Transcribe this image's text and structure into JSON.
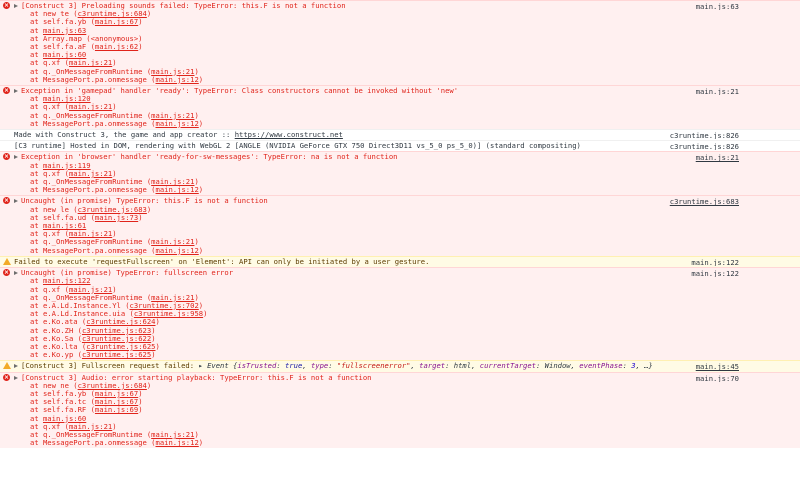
{
  "messages": [
    {
      "type": "error",
      "text": "[Construct 3] Preloading sounds failed:  TypeError: this.F is not a function",
      "source": "main.js:63",
      "frames": [
        {
          "pre": "at new te (",
          "loc": "c3runtime.js:684",
          "post": ")"
        },
        {
          "pre": "at self.fa.yb (",
          "loc": "main.js:67",
          "post": ")"
        },
        {
          "pre": "at ",
          "loc": "main.js:63",
          "post": ""
        },
        {
          "pre": "at Array.map (<anonymous>)",
          "loc": "",
          "post": ""
        },
        {
          "pre": "at self.fa.aF (",
          "loc": "main.js:62",
          "post": ")"
        },
        {
          "pre": "at ",
          "loc": "main.js:60",
          "post": ""
        },
        {
          "pre": "at q.xf (",
          "loc": "main.js:21",
          "post": ")"
        },
        {
          "pre": "at q._OnMessageFromRuntime (",
          "loc": "main.js:21",
          "post": ")"
        },
        {
          "pre": "at MessagePort.pa.onmessage (",
          "loc": "main.js:12",
          "post": ")"
        }
      ]
    },
    {
      "type": "error",
      "text": "Exception in 'gamepad' handler 'ready': TypeError: Class constructors cannot be invoked without 'new'",
      "source": "main.js:21",
      "frames": [
        {
          "pre": "at ",
          "loc": "main.js:120",
          "post": ""
        },
        {
          "pre": "at q.xf (",
          "loc": "main.js:21",
          "post": ")"
        },
        {
          "pre": "at q._OnMessageFromRuntime (",
          "loc": "main.js:21",
          "post": ")"
        },
        {
          "pre": "at MessagePort.pa.onmessage (",
          "loc": "main.js:12",
          "post": ")"
        }
      ]
    },
    {
      "type": "log",
      "text": "Made with Construct 3, the game and app creator :: ",
      "link": "https://www.construct.net",
      "source": "c3runtime.js:826",
      "frames": []
    },
    {
      "type": "log",
      "text": "[C3 runtime] Hosted in DOM, rendering with WebGL 2 [ANGLE (NVIDIA GeForce GTX 750 Direct3D11 vs_5_0 ps_5_0)] (standard compositing)",
      "source": "c3runtime.js:826",
      "frames": []
    },
    {
      "type": "error",
      "text": "Exception in 'browser' handler 'ready-for-sw-messages': TypeError: na is not a function",
      "source": "main.js:21",
      "frames": [
        {
          "pre": "at ",
          "loc": "main.js:119",
          "post": ""
        },
        {
          "pre": "at q.xf (",
          "loc": "main.js:21",
          "post": ")"
        },
        {
          "pre": "at q._OnMessageFromRuntime (",
          "loc": "main.js:21",
          "post": ")"
        },
        {
          "pre": "at MessagePort.pa.onmessage (",
          "loc": "main.js:12",
          "post": ")"
        }
      ]
    },
    {
      "type": "error",
      "text": "Uncaught (in promise) TypeError: this.F is not a function",
      "source": "c3runtime.js:683",
      "frames": [
        {
          "pre": "at new le (",
          "loc": "c3runtime.js:683",
          "post": ")"
        },
        {
          "pre": "at self.fa.ud (",
          "loc": "main.js:73",
          "post": ")"
        },
        {
          "pre": "at ",
          "loc": "main.js:61",
          "post": ""
        },
        {
          "pre": "at q.xf (",
          "loc": "main.js:21",
          "post": ")"
        },
        {
          "pre": "at q._OnMessageFromRuntime (",
          "loc": "main.js:21",
          "post": ")"
        },
        {
          "pre": "at MessagePort.pa.onmessage (",
          "loc": "main.js:12",
          "post": ")"
        }
      ]
    },
    {
      "type": "warn",
      "text": "Failed to execute 'requestFullscreen' on 'Element': API can only be initiated by a user gesture.",
      "source": "main.js:122",
      "frames": []
    },
    {
      "type": "error",
      "text": "Uncaught (in promise) TypeError: fullscreen error",
      "source": "main.js:122",
      "frames": [
        {
          "pre": "at ",
          "loc": "main.js:122",
          "post": ""
        },
        {
          "pre": "at q.xf (",
          "loc": "main.js:21",
          "post": ")"
        },
        {
          "pre": "at q._OnMessageFromRuntime (",
          "loc": "main.js:21",
          "post": ")"
        },
        {
          "pre": "at e.A.Ld.Instance.Yl (",
          "loc": "c3runtime.js:702",
          "post": ")"
        },
        {
          "pre": "at e.A.Ld.Instance.uia (",
          "loc": "c3runtime.js:958",
          "post": ")"
        },
        {
          "pre": "at e.Ko.ata (",
          "loc": "c3runtime.js:624",
          "post": ")"
        },
        {
          "pre": "at e.Ko.ZH (",
          "loc": "c3runtime.js:623",
          "post": ")"
        },
        {
          "pre": "at e.Ko.Sa (",
          "loc": "c3runtime.js:622",
          "post": ")"
        },
        {
          "pre": "at e.Ko.lta (",
          "loc": "c3runtime.js:625",
          "post": ")"
        },
        {
          "pre": "at e.Ko.yp (",
          "loc": "c3runtime.js:625",
          "post": ")"
        }
      ]
    },
    {
      "type": "warn",
      "text": "[Construct 3] Fullscreen request failed:  ",
      "object": {
        "lead": "Event {",
        "parts": [
          {
            "k": "isTrusted",
            "v": "true",
            "vt": "bv"
          },
          {
            "k": "type",
            "v": "\"fullscreenerror\"",
            "vt": "sv"
          },
          {
            "k": "target",
            "v": "html",
            "vt": ""
          },
          {
            "k": "currentTarget",
            "v": "Window",
            "vt": ""
          },
          {
            "k": "eventPhase",
            "v": "3",
            "vt": "nv"
          }
        ],
        "tail": ", …}"
      },
      "source": "main.js:45",
      "frames": []
    },
    {
      "type": "error",
      "text": "[Construct 3] Audio: error starting playback:  TypeError: this.F is not a function",
      "source": "main.js:70",
      "frames": [
        {
          "pre": "at new ne (",
          "loc": "c3runtime.js:684",
          "post": ")"
        },
        {
          "pre": "at self.fa.yb (",
          "loc": "main.js:67",
          "post": ")"
        },
        {
          "pre": "at self.fa.tc (",
          "loc": "main.js:67",
          "post": ")"
        },
        {
          "pre": "at self.fa.RF (",
          "loc": "main.js:69",
          "post": ")"
        },
        {
          "pre": "at ",
          "loc": "main.js:60",
          "post": ""
        },
        {
          "pre": "at q.xf (",
          "loc": "main.js:21",
          "post": ")"
        },
        {
          "pre": "at q._OnMessageFromRuntime (",
          "loc": "main.js:21",
          "post": ")"
        },
        {
          "pre": "at MessagePort.pa.onmessage (",
          "loc": "main.js:12",
          "post": ")"
        }
      ]
    }
  ]
}
